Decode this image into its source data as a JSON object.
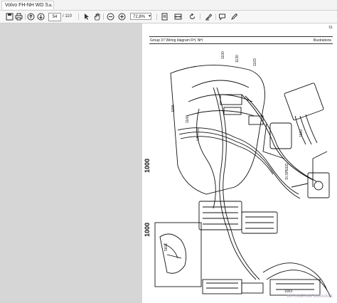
{
  "tab": {
    "title": "Volvo FH-NH WD S...",
    "close": "×"
  },
  "toolbar": {
    "page_current": "54",
    "page_total": "/ 110",
    "zoom": "72,8%"
  },
  "document": {
    "page_number": "51",
    "header_left": "Group 37 Wiring diagram FH, NH",
    "header_right": "Illustrations",
    "side_code_1": "1000",
    "side_code_2": "1000",
    "callout_label": "SI-SPEED",
    "watermark": "AUTOREPAIR MANUALS"
  }
}
